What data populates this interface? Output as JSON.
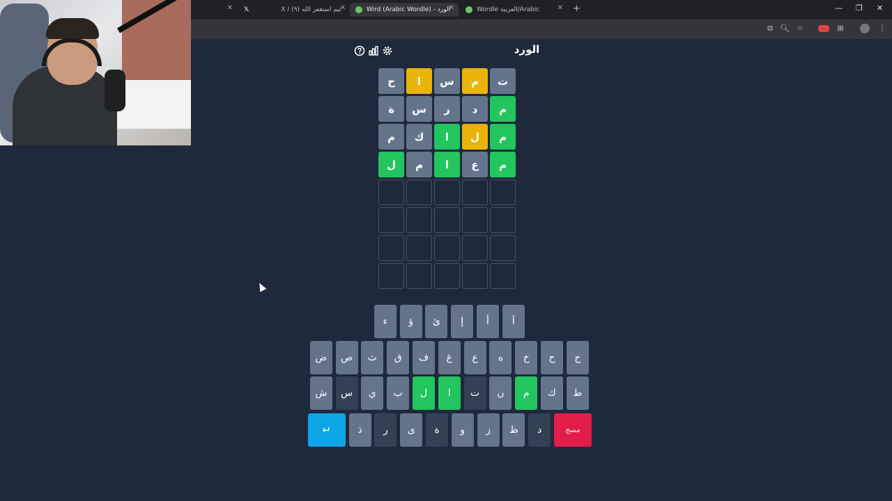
{
  "browser": {
    "tabs": [
      {
        "title": "",
        "favicon": "x-logo-icon",
        "active": false
      },
      {
        "title": "X / (٩) ثيم استغفر الله",
        "favicon": "",
        "active": false
      },
      {
        "title": "الورد - AlWird (Arabic Wordle)",
        "favicon": "green-circle-icon",
        "active": true
      },
      {
        "title": "Wordle العربية/Arabic",
        "favicon": "green-circle-icon",
        "active": false
      }
    ],
    "new_tab_icon": "+",
    "window_controls": [
      "—",
      "❐",
      "✕"
    ]
  },
  "game": {
    "title": "الورد",
    "header_icons": [
      "help-icon",
      "stats-icon",
      "settings-icon"
    ],
    "board": [
      [
        {
          "l": "ت",
          "s": "absent"
        },
        {
          "l": "م",
          "s": "present"
        },
        {
          "l": "س",
          "s": "absent"
        },
        {
          "l": "ا",
          "s": "present"
        },
        {
          "l": "ح",
          "s": "absent"
        }
      ],
      [
        {
          "l": "م",
          "s": "correct"
        },
        {
          "l": "د",
          "s": "absent"
        },
        {
          "l": "ر",
          "s": "absent"
        },
        {
          "l": "س",
          "s": "absent"
        },
        {
          "l": "ة",
          "s": "absent"
        }
      ],
      [
        {
          "l": "م",
          "s": "correct"
        },
        {
          "l": "ل",
          "s": "present"
        },
        {
          "l": "ا",
          "s": "correct"
        },
        {
          "l": "ك",
          "s": "absent"
        },
        {
          "l": "م",
          "s": "absent"
        }
      ],
      [
        {
          "l": "م",
          "s": "correct"
        },
        {
          "l": "ع",
          "s": "absent"
        },
        {
          "l": "ا",
          "s": "correct"
        },
        {
          "l": "م",
          "s": "absent"
        },
        {
          "l": "ل",
          "s": "correct"
        }
      ],
      [
        {
          "l": "",
          "s": "empty"
        },
        {
          "l": "",
          "s": "empty"
        },
        {
          "l": "",
          "s": "empty"
        },
        {
          "l": "",
          "s": "empty"
        },
        {
          "l": "",
          "s": "empty"
        }
      ],
      [
        {
          "l": "",
          "s": "empty"
        },
        {
          "l": "",
          "s": "empty"
        },
        {
          "l": "",
          "s": "empty"
        },
        {
          "l": "",
          "s": "empty"
        },
        {
          "l": "",
          "s": "empty"
        }
      ],
      [
        {
          "l": "",
          "s": "empty"
        },
        {
          "l": "",
          "s": "empty"
        },
        {
          "l": "",
          "s": "empty"
        },
        {
          "l": "",
          "s": "empty"
        },
        {
          "l": "",
          "s": "empty"
        }
      ],
      [
        {
          "l": "",
          "s": "empty"
        },
        {
          "l": "",
          "s": "empty"
        },
        {
          "l": "",
          "s": "empty"
        },
        {
          "l": "",
          "s": "empty"
        },
        {
          "l": "",
          "s": "empty"
        }
      ]
    ],
    "keyboard": [
      [
        {
          "k": "آ"
        },
        {
          "k": "أ"
        },
        {
          "k": "إ"
        },
        {
          "k": "ئ"
        },
        {
          "k": "ؤ"
        },
        {
          "k": "ء"
        }
      ],
      [
        {
          "k": "ج"
        },
        {
          "k": "ح"
        },
        {
          "k": "خ"
        },
        {
          "k": "ه"
        },
        {
          "k": "ع"
        },
        {
          "k": "غ"
        },
        {
          "k": "ف"
        },
        {
          "k": "ق"
        },
        {
          "k": "ث"
        },
        {
          "k": "ص"
        },
        {
          "k": "ض"
        }
      ],
      [
        {
          "k": "ط"
        },
        {
          "k": "ك"
        },
        {
          "k": "م",
          "s": "correct"
        },
        {
          "k": "ن"
        },
        {
          "k": "ت",
          "s": "dark"
        },
        {
          "k": "ا",
          "s": "correct"
        },
        {
          "k": "ل",
          "s": "correct"
        },
        {
          "k": "ب"
        },
        {
          "k": "ي"
        },
        {
          "k": "س",
          "s": "dark"
        },
        {
          "k": "ش"
        }
      ],
      [
        {
          "k": "مسح",
          "s": "del"
        },
        {
          "k": "د",
          "s": "dark"
        },
        {
          "k": "ظ"
        },
        {
          "k": "ز"
        },
        {
          "k": "و"
        },
        {
          "k": "ة",
          "s": "dark"
        },
        {
          "k": "ى"
        },
        {
          "k": "ر",
          "s": "dark"
        },
        {
          "k": "ذ"
        },
        {
          "k": "↵",
          "s": "enter"
        }
      ]
    ]
  },
  "colors": {
    "background": "#1e293b",
    "correct": "#22c55e",
    "present": "#eab308",
    "absent": "#64748b",
    "enter": "#0ea5e9",
    "delete": "#e11d48"
  }
}
